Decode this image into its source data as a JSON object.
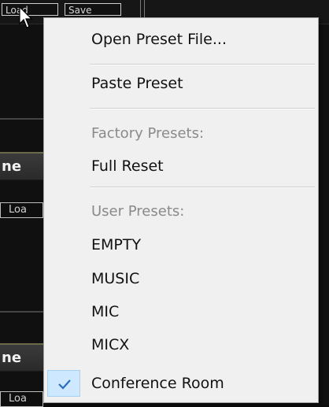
{
  "background": {
    "top_buttons": [
      "Load",
      "Save"
    ],
    "channel_strips": [
      "ne",
      "ne"
    ],
    "small_buttons": [
      "Loa",
      "Loa"
    ]
  },
  "menu": {
    "items": [
      {
        "label": "Open Preset File...",
        "enabled": true
      },
      {
        "label": "Paste Preset",
        "enabled": true
      },
      {
        "label": "Factory Presets:",
        "enabled": false
      },
      {
        "label": "Full Reset",
        "enabled": true
      },
      {
        "label": "User Presets:",
        "enabled": false
      },
      {
        "label": "EMPTY",
        "enabled": true
      },
      {
        "label": "MUSIC",
        "enabled": true
      },
      {
        "label": "MIC",
        "enabled": true
      },
      {
        "label": "MICX",
        "enabled": true
      },
      {
        "label": "Conference Room",
        "enabled": true,
        "checked": true
      }
    ]
  },
  "colors": {
    "menu_bg": "#f0f0f0",
    "check_highlight": "#cde8ff",
    "check_mark": "#2a6ebd"
  },
  "icons": {
    "checked": "check-icon",
    "pointer": "mouse-cursor-icon"
  }
}
